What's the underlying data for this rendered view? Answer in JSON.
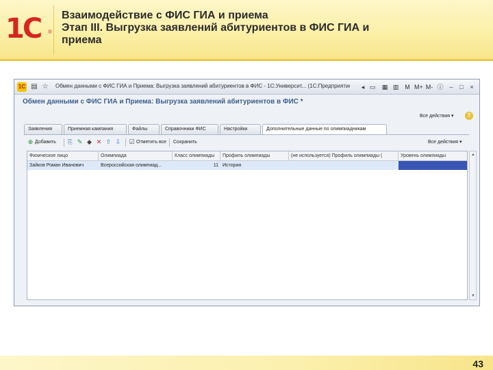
{
  "slide": {
    "logo": "1С",
    "title_line1": "Взаимодействие с ФИС ГИА и приема",
    "title_line2": "Этап III. Выгрузка заявлений абитуриентов в ФИС ГИА и",
    "title_line3": "приема",
    "page_number": "43"
  },
  "window": {
    "title": "Обмен данными с ФИС ГИА и Приема: Выгрузка заявлений абитуриентов в ФИС - 1С:Университ... (1С:Предприятие)",
    "controls": {
      "m": "M",
      "m_plus": "M+",
      "m_minus": "M-",
      "minimize": "–",
      "maximize": "□",
      "close": "×"
    }
  },
  "form": {
    "title": "Обмен данными с ФИС ГИА и Приема: Выгрузка заявлений абитуриентов в ФИС *",
    "all_actions": "Все действия ▾",
    "help": "?"
  },
  "tabs": [
    {
      "label": "Заявления"
    },
    {
      "label": "Приемная кампания"
    },
    {
      "label": "Файлы"
    },
    {
      "label": "Справочники ФИС"
    },
    {
      "label": "Настройки"
    },
    {
      "label": "Дополнительные данные по олимпиадникам"
    }
  ],
  "toolbar": {
    "add": "Добавить",
    "select_all": "Отметить все",
    "save": "Сохранить",
    "all_actions": "Все действия ▾"
  },
  "table": {
    "columns": [
      "Физическое лицо",
      "Олимпиада",
      "Класс олимпиады",
      "Профиль олимпиады",
      "(не используется) Профиль олимпиады (",
      "Уровень олимпиады"
    ],
    "rows": [
      [
        "Зайков Роман Иванович",
        "Всероссийская олимпиад...",
        "11",
        "История",
        "",
        ""
      ]
    ]
  },
  "colors": {
    "accent_header": "#3d5e8b",
    "selected_cell": "#3a55b4",
    "row_highlight": "#dde9f8",
    "logo_red": "#d7261e"
  }
}
